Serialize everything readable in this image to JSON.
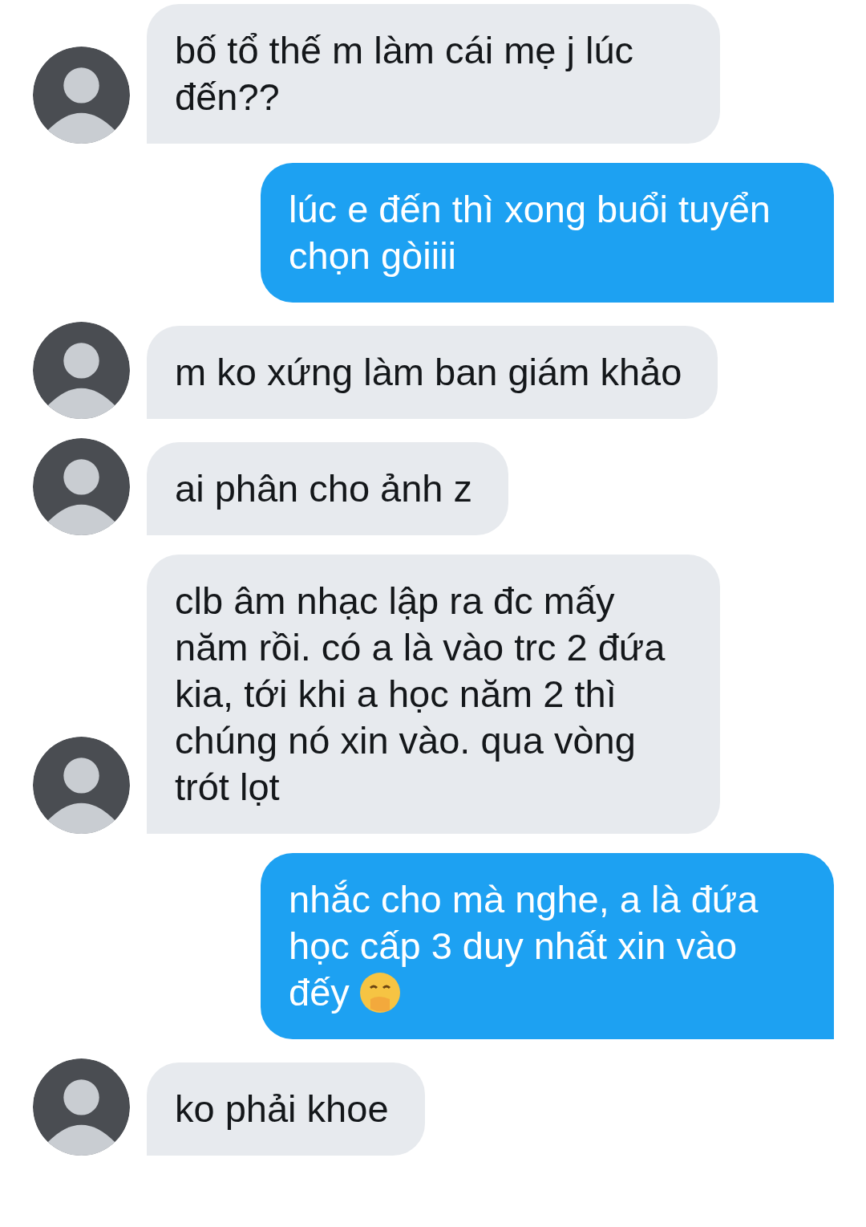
{
  "messages": [
    {
      "kind": "received",
      "text": "bố tổ thế m làm cái mẹ j lúc đến??"
    },
    {
      "kind": "sent",
      "text": "lúc e đến thì xong buổi tuyển chọn gòiiii"
    },
    {
      "kind": "received",
      "text": "m ko xứng làm ban giám khảo"
    },
    {
      "kind": "received",
      "text": "ai phân cho ảnh z"
    },
    {
      "kind": "received",
      "text": "clb âm nhạc lập ra đc mấy năm rồi. có a là vào trc 2 đứa kia, tới khi a học năm 2 thì chúng nó xin vào. qua vòng trót lọt"
    },
    {
      "kind": "sent",
      "text": "nhắc cho mà nghe, a là đứa học cấp 3 duy nhất xin vào đếy",
      "has_emoji": true
    },
    {
      "kind": "received",
      "text": "ko phải khoe"
    }
  ]
}
